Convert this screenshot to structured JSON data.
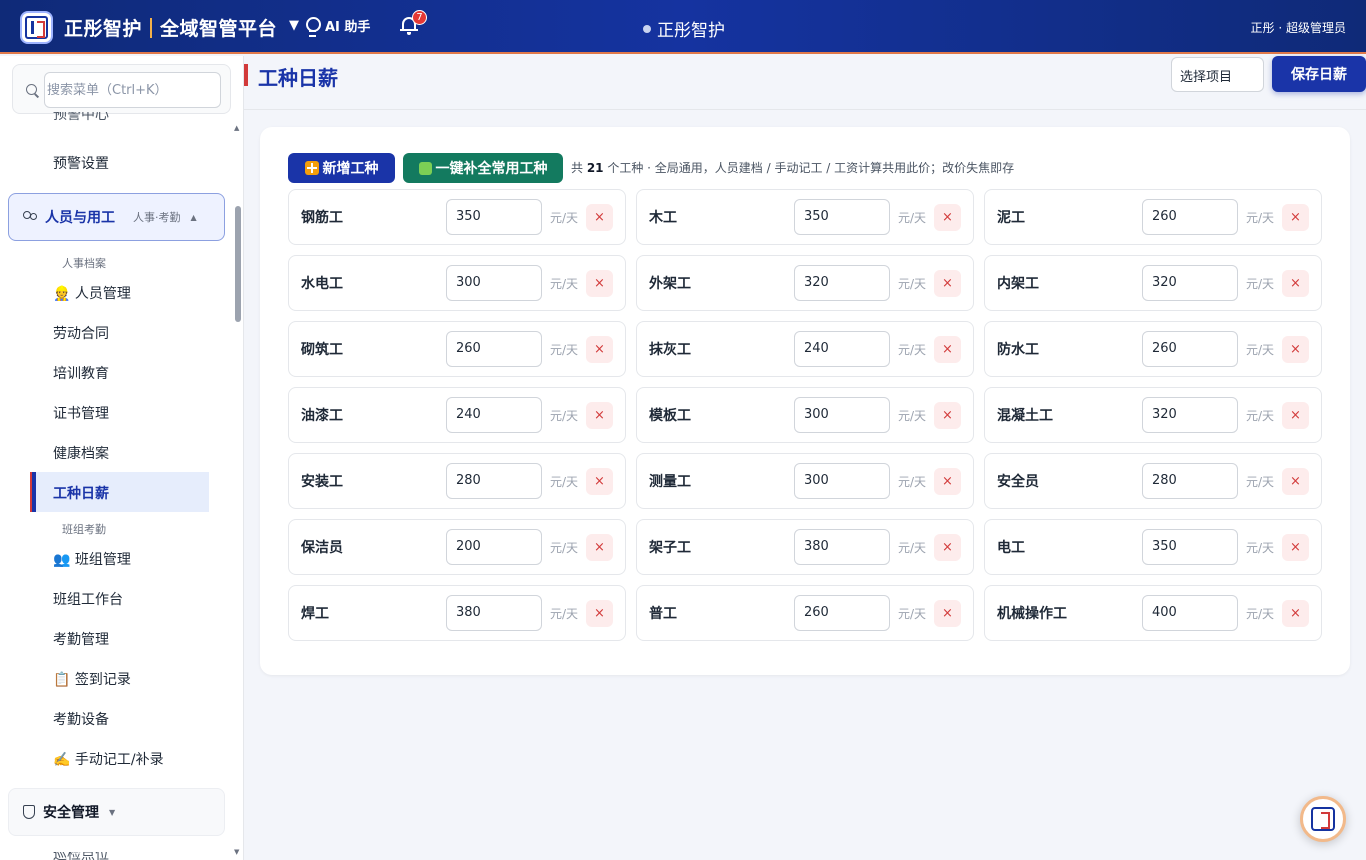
{
  "header": {
    "brand_name": "正彤智护",
    "platform_name": "全域智管平台",
    "caret": "▼",
    "ai_label": "AI 助手",
    "notification_count": "7",
    "center_title": "正彤智护",
    "user_label": "正彤 · 超级管理员"
  },
  "sidebar": {
    "search_placeholder": "搜索菜单（Ctrl+K）",
    "cut_item": "预警中心",
    "item_alert_settings": "预警设置",
    "group_people": {
      "title": "人员与用工",
      "subtitle": "人事·考勤",
      "caret": "▲"
    },
    "section_hr": "人事档案",
    "items_hr": [
      "👷 人员管理",
      "劳动合同",
      "培训教育",
      "证书管理",
      "健康档案",
      "工种日薪"
    ],
    "section_team": "班组考勤",
    "items_team": [
      "👥 班组管理",
      "班组工作台",
      "考勤管理",
      "📋 签到记录",
      "考勤设备",
      "✍️ 手动记工/补录"
    ],
    "group_safety": {
      "title": "安全管理",
      "caret": "▼"
    },
    "cut_item_bottom": "巡检点位"
  },
  "page": {
    "title": "工种日薪",
    "project_select": "选择项目",
    "save_label": "保存日薪"
  },
  "toolbar": {
    "add_label": "新增工种",
    "fill_label": "一键补全常用工种",
    "summary_prefix": "共 ",
    "summary_count": "21",
    "summary_suffix": " 个工种 · 全局通用，人员建档 / 手动记工 / 工资计算共用此价；改价失焦即存"
  },
  "unit_label": "元/天",
  "delete_glyph": "×",
  "workers": [
    {
      "name": "钢筋工",
      "rate": "350"
    },
    {
      "name": "木工",
      "rate": "350"
    },
    {
      "name": "泥工",
      "rate": "260"
    },
    {
      "name": "水电工",
      "rate": "300"
    },
    {
      "name": "外架工",
      "rate": "320"
    },
    {
      "name": "内架工",
      "rate": "320"
    },
    {
      "name": "砌筑工",
      "rate": "260"
    },
    {
      "name": "抹灰工",
      "rate": "240"
    },
    {
      "name": "防水工",
      "rate": "260"
    },
    {
      "name": "油漆工",
      "rate": "240"
    },
    {
      "name": "模板工",
      "rate": "300"
    },
    {
      "name": "混凝土工",
      "rate": "320"
    },
    {
      "name": "安装工",
      "rate": "280"
    },
    {
      "name": "测量工",
      "rate": "300"
    },
    {
      "name": "安全员",
      "rate": "280"
    },
    {
      "name": "保洁员",
      "rate": "200"
    },
    {
      "name": "架子工",
      "rate": "380"
    },
    {
      "name": "电工",
      "rate": "350"
    },
    {
      "name": "焊工",
      "rate": "380"
    },
    {
      "name": "普工",
      "rate": "260"
    },
    {
      "name": "机械操作工",
      "rate": "400"
    }
  ]
}
